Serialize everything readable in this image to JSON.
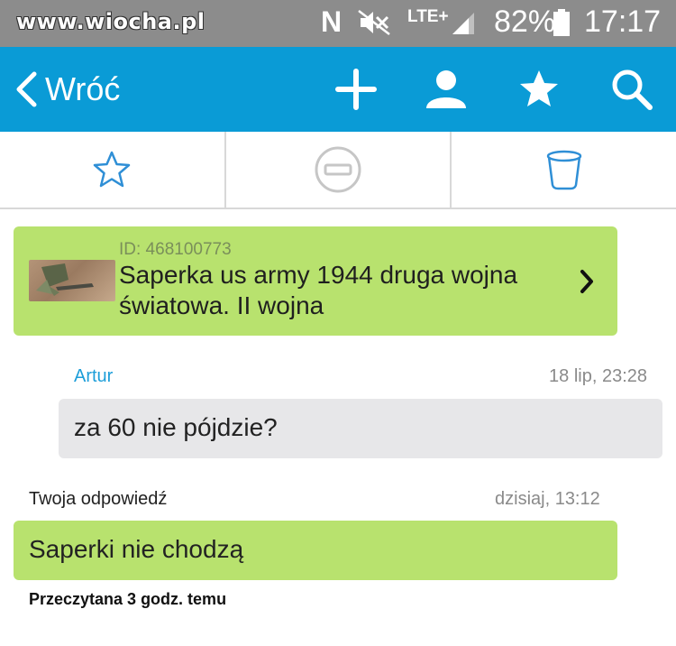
{
  "status_bar": {
    "watermark": "www.wiocha.pl",
    "network_letter": "N",
    "network_type": "LTE+",
    "battery": "82%",
    "time": "17:17"
  },
  "toolbar": {
    "back_label": "Wróć",
    "icons": [
      "plus-icon",
      "person-icon",
      "star-icon",
      "search-icon"
    ],
    "color": "#0a9bd6"
  },
  "actions": {
    "icons": [
      "star-outline-icon",
      "block-icon",
      "trash-icon"
    ],
    "accent": "#2f8fd6"
  },
  "offer": {
    "id_text": "ID: 468100773",
    "title": "Saperka us army 1944 druga wojna światowa. II wojna",
    "color": "#b8e26e"
  },
  "thread": {
    "incoming": {
      "sender": "Artur",
      "timestamp": "18 lip, 23:28",
      "text": "za 60 nie pójdzie?"
    },
    "outgoing": {
      "label": "Twoja odpowiedź",
      "timestamp": "dzisiaj, 13:12",
      "text": "Saperki nie chodzą",
      "read_status": "Przeczytana 3 godz. temu"
    }
  }
}
